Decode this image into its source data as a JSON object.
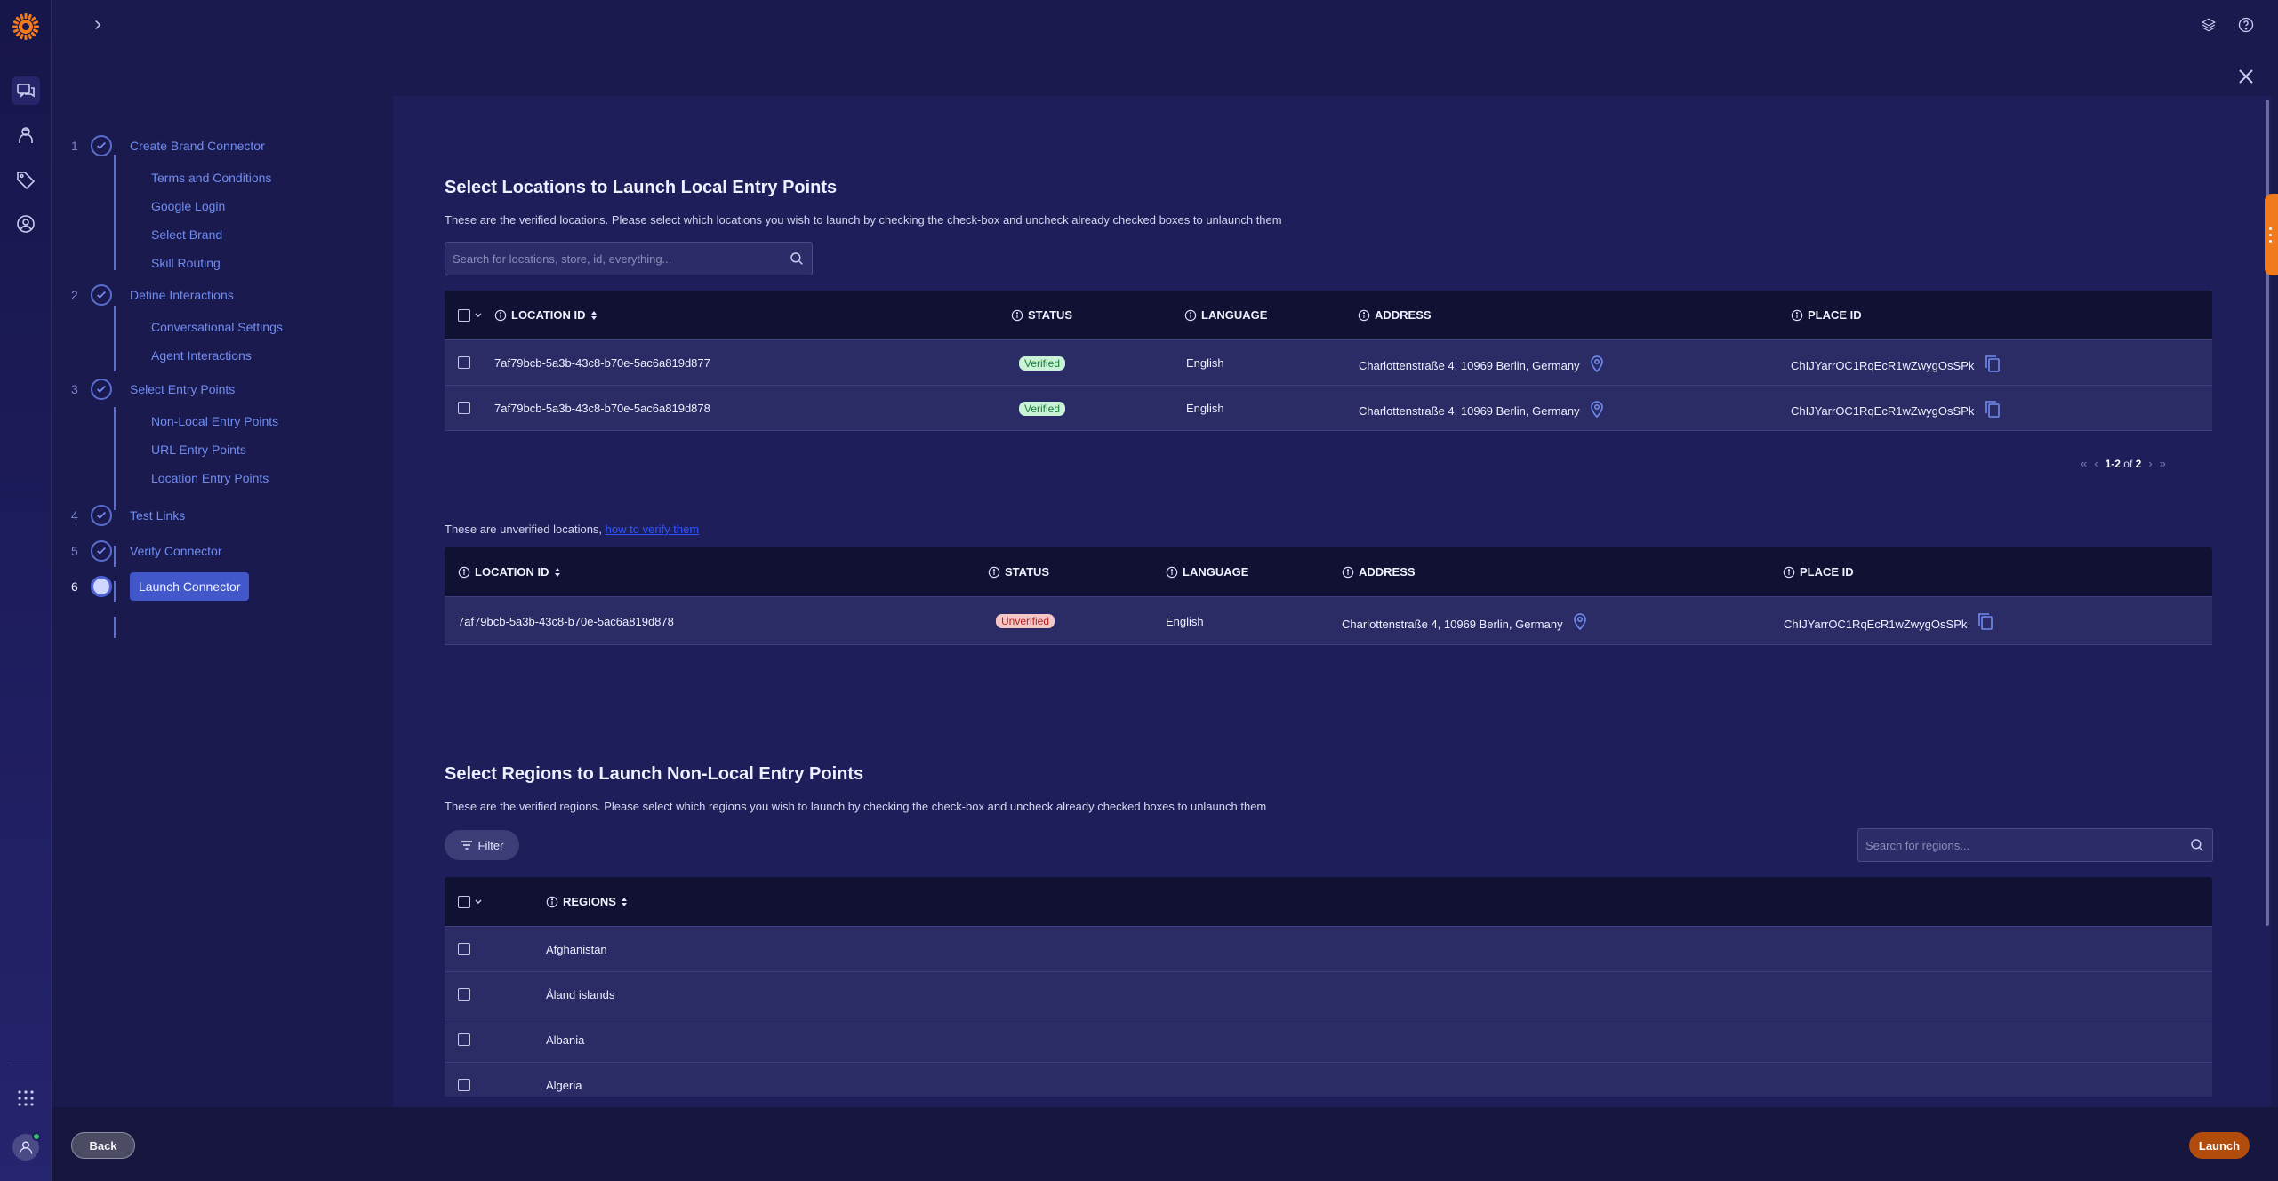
{
  "brand": {
    "accent": "#f07a1c",
    "primary": "#4257c9"
  },
  "rail": {
    "icons": [
      "messages-icon",
      "agent-icon",
      "tag-icon",
      "account-icon",
      "apps-grid-icon",
      "user-avatar-icon"
    ]
  },
  "stepper": {
    "steps": [
      {
        "num": "1",
        "label": "Create Brand Connector",
        "sub": [
          "Terms and Conditions",
          "Google Login",
          "Select Brand",
          "Skill Routing"
        ]
      },
      {
        "num": "2",
        "label": "Define Interactions",
        "sub": [
          "Conversational Settings",
          "Agent Interactions"
        ]
      },
      {
        "num": "3",
        "label": "Select Entry Points",
        "sub": [
          "Non-Local Entry Points",
          "URL Entry Points",
          "Location Entry Points"
        ]
      },
      {
        "num": "4",
        "label": "Test Links",
        "sub": []
      },
      {
        "num": "5",
        "label": "Verify Connector",
        "sub": []
      },
      {
        "num": "6",
        "label": "Launch Connector",
        "sub": []
      }
    ]
  },
  "locations": {
    "title": "Select Locations to Launch Local Entry Points",
    "description": "These are the verified locations. Please select which locations you wish to launch by checking the check-box and uncheck already checked boxes to unlaunch them",
    "search_placeholder": "Search for locations, store, id, everything...",
    "columns": {
      "location_id": "LOCATION ID",
      "status": "STATUS",
      "language": "LANGUAGE",
      "address": "ADDRESS",
      "place_id": "PLACE ID"
    },
    "rows": [
      {
        "location_id": "7af79bcb-5a3b-43c8-b70e-5ac6a819d877",
        "status": "Verified",
        "language": "English",
        "address": "Charlottenstraße 4, 10969 Berlin, Germany",
        "place_id": "ChIJYarrOC1RqEcR1wZwygOsSPk"
      },
      {
        "location_id": "7af79bcb-5a3b-43c8-b70e-5ac6a819d878",
        "status": "Verified",
        "language": "English",
        "address": "Charlottenstraße 4, 10969 Berlin, Germany",
        "place_id": "ChIJYarrOC1RqEcR1wZwygOsSPk"
      }
    ],
    "pagination": {
      "range": "1-2",
      "of_label": "of",
      "total": "2"
    }
  },
  "unverified": {
    "description": "These are unverified locations,",
    "link": "how to verify them",
    "columns": {
      "location_id": "LOCATION ID",
      "status": "STATUS",
      "language": "LANGUAGE",
      "address": "ADDRESS",
      "place_id": "PLACE ID"
    },
    "rows": [
      {
        "location_id": "7af79bcb-5a3b-43c8-b70e-5ac6a819d878",
        "status": "Unverified",
        "language": "English",
        "address": "Charlottenstraße 4, 10969 Berlin, Germany",
        "place_id": "ChIJYarrOC1RqEcR1wZwygOsSPk"
      }
    ]
  },
  "regions": {
    "title": "Select Regions to Launch Non-Local Entry Points",
    "description": "These are the verified regions. Please select which regions you wish to launch by checking the check-box and uncheck already checked boxes to unlaunch them",
    "filter_label": "Filter",
    "search_placeholder": "Search for regions...",
    "column": "REGIONS",
    "rows": [
      "Afghanistan",
      "Åland islands",
      "Albania",
      "Algeria"
    ]
  },
  "footer": {
    "back_label": "Back",
    "launch_label": "Launch"
  }
}
